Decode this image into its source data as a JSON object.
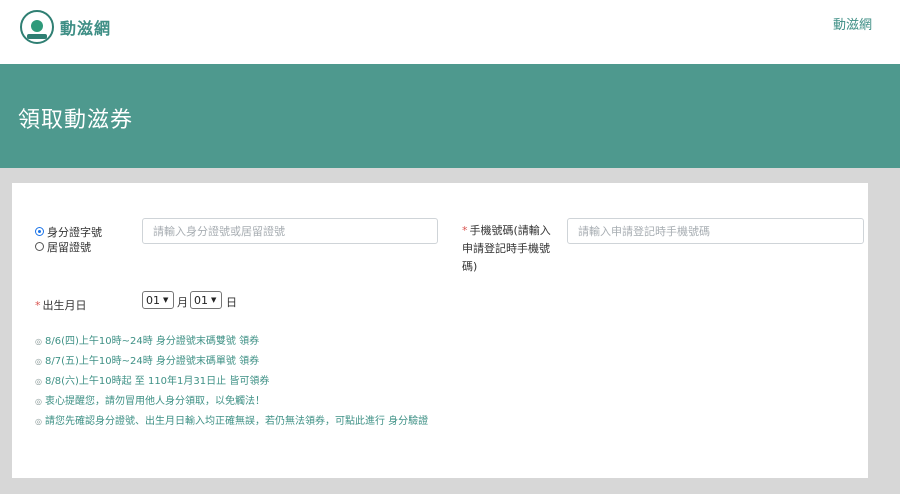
{
  "header": {
    "logo_text": "動滋網",
    "nav_link": "動滋網"
  },
  "banner": {
    "title": "領取動滋券"
  },
  "form": {
    "id_type_options": [
      {
        "label": "身分證字號",
        "checked": true
      },
      {
        "label": "居留證號",
        "checked": false
      }
    ],
    "id_input_placeholder": "請輸入身分證號或居留證號",
    "phone_required_mark": "*",
    "phone_label": "手機號碼(請輸入申請登記時手機號碼)",
    "phone_input_placeholder": "請輸入申請登記時手機號碼",
    "dob_required_mark": "*",
    "dob_label": "出生月日",
    "month_value": "01",
    "month_unit": "月",
    "day_value": "01",
    "day_unit": "日"
  },
  "notes": [
    "8/6(四)上午10時~24時 身分證號末碼雙號 領券",
    "8/7(五)上午10時~24時 身分證號末碼單號 領券",
    "8/8(六)上午10時起 至 110年1月31日止 皆可領券",
    "衷心提醒您，請勿冒用他人身分領取，以免觸法！",
    "請您先確認身分證號、出生月日輸入均正確無誤，若仍無法領券，可點此進行 身分驗證"
  ],
  "colors": {
    "brand_teal": "#4e998e",
    "link_teal": "#3f8f86",
    "note_teal": "#3f9186",
    "required_red": "#d9534f",
    "page_gray": "#d7d7d7"
  }
}
